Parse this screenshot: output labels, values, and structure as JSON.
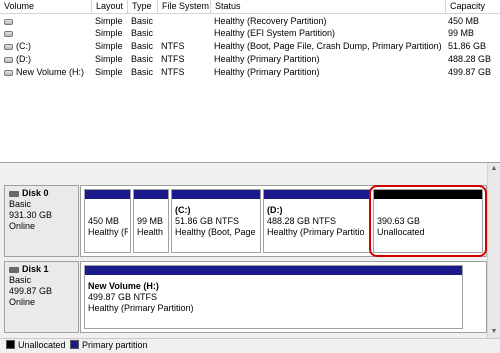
{
  "columns": {
    "volume": "Volume",
    "layout": "Layout",
    "type": "Type",
    "filesystem": "File System",
    "status": "Status",
    "capacity": "Capacity"
  },
  "volumes": [
    {
      "name": "",
      "layout": "Simple",
      "type": "Basic",
      "fs": "",
      "status": "Healthy (Recovery Partition)",
      "capacity": "450 MB"
    },
    {
      "name": "",
      "layout": "Simple",
      "type": "Basic",
      "fs": "",
      "status": "Healthy (EFI System Partition)",
      "capacity": "99 MB"
    },
    {
      "name": "(C:)",
      "layout": "Simple",
      "type": "Basic",
      "fs": "NTFS",
      "status": "Healthy (Boot, Page File, Crash Dump, Primary Partition)",
      "capacity": "51.86 GB"
    },
    {
      "name": "(D:)",
      "layout": "Simple",
      "type": "Basic",
      "fs": "NTFS",
      "status": "Healthy (Primary Partition)",
      "capacity": "488.28 GB"
    },
    {
      "name": "New Volume (H:)",
      "layout": "Simple",
      "type": "Basic",
      "fs": "NTFS",
      "status": "Healthy (Primary Partition)",
      "capacity": "499.87 GB"
    }
  ],
  "disks": [
    {
      "title": "Disk 0",
      "kind": "Basic",
      "size": "931.30 GB",
      "state": "Online",
      "partitions": [
        {
          "name": "",
          "line1": "450 MB",
          "line2": "Healthy (R"
        },
        {
          "name": "",
          "line1": "99 MB",
          "line2": "Health"
        },
        {
          "name": "(C:)",
          "line1": "51.86 GB NTFS",
          "line2": "Healthy (Boot, Page"
        },
        {
          "name": "(D:)",
          "line1": "488.28 GB NTFS",
          "line2": "Healthy (Primary Partitio"
        },
        {
          "name": "",
          "line1": "390.63 GB",
          "line2": "Unallocated"
        }
      ]
    },
    {
      "title": "Disk 1",
      "kind": "Basic",
      "size": "499.87 GB",
      "state": "Online",
      "partitions": [
        {
          "name": "New Volume  (H:)",
          "line1": "499.87 GB NTFS",
          "line2": "Healthy (Primary Partition)"
        }
      ]
    }
  ],
  "legend": {
    "unallocated": "Unallocated",
    "primary": "Primary partition"
  },
  "colors": {
    "primary_bar": "#1a1a8a",
    "unallocated_bar": "#000000",
    "highlight": "#d40000"
  }
}
